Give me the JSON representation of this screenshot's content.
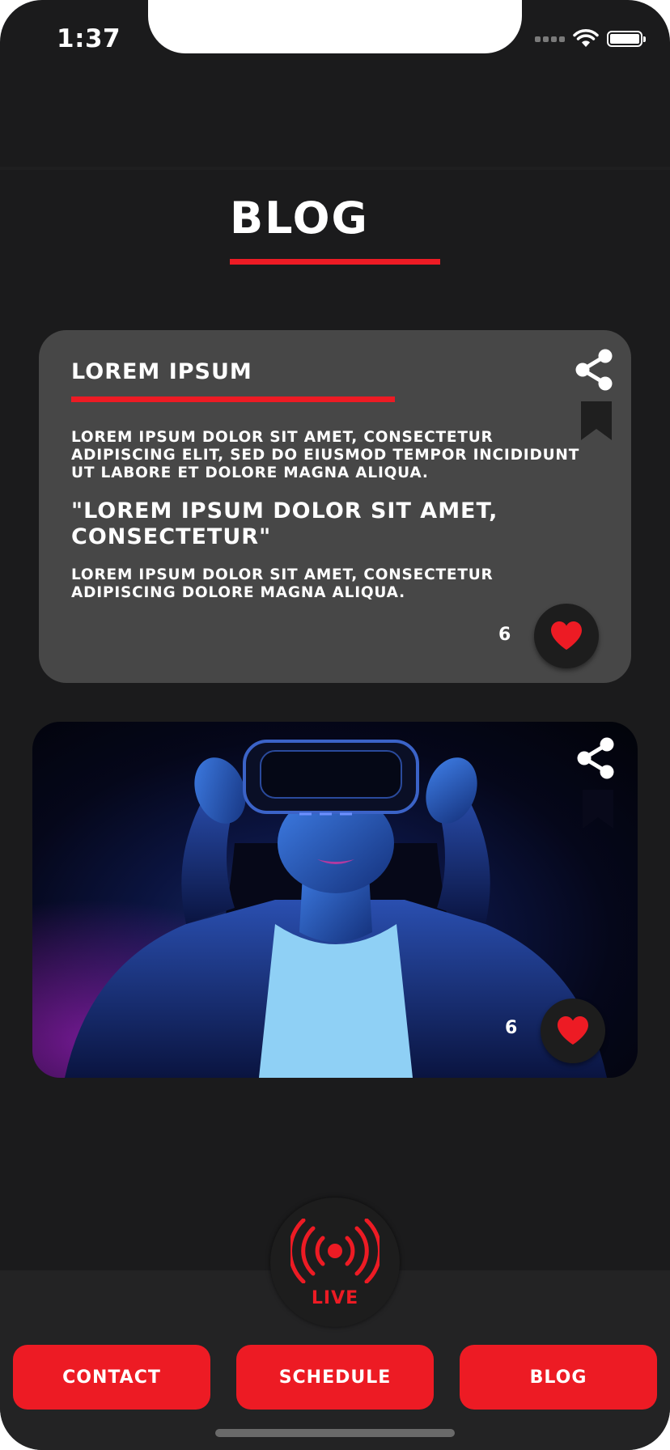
{
  "status_bar": {
    "time": "1:37"
  },
  "page": {
    "title": "BLOG"
  },
  "posts": [
    {
      "title": "LOREM IPSUM",
      "paragraph1": "LOREM IPSUM DOLOR SIT AMET, CONSECTETUR ADIPISCING ELIT, SED DO EIUSMOD TEMPOR INCIDIDUNT UT LABORE ET DOLORE MAGNA ALIQUA.",
      "quote": "\"LOREM IPSUM DOLOR SIT AMET, CONSECTETUR\"",
      "paragraph2": "LOREM IPSUM DOLOR SIT AMET, CONSECTETUR ADIPISCING DOLORE MAGNA ALIQUA.",
      "likes": "6"
    },
    {
      "likes": "6"
    }
  ],
  "live": {
    "label": "LIVE"
  },
  "tabs": [
    {
      "label": "CONTACT"
    },
    {
      "label": "SCHEDULE"
    },
    {
      "label": "BLOG"
    }
  ],
  "colors": {
    "accent": "#ed1b24",
    "background": "#1b1b1c",
    "card": "#474747"
  },
  "icons": [
    "share-icon",
    "bookmark-icon",
    "heart-icon",
    "broadcast-icon",
    "wifi-icon",
    "battery-icon",
    "signal-icon"
  ]
}
